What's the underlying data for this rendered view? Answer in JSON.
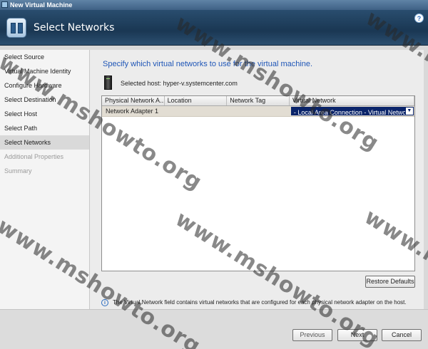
{
  "window": {
    "title": "New Virtual Machine"
  },
  "header": {
    "title": "Select Networks",
    "help_glyph": "?"
  },
  "sidebar": {
    "items": [
      {
        "label": "Select Source",
        "state": "normal"
      },
      {
        "label": "Virtual Machine Identity",
        "state": "normal"
      },
      {
        "label": "Configure Hardware",
        "state": "normal"
      },
      {
        "label": "Select Destination",
        "state": "normal"
      },
      {
        "label": "Select Host",
        "state": "normal"
      },
      {
        "label": "Select Path",
        "state": "normal"
      },
      {
        "label": "Select Networks",
        "state": "active"
      },
      {
        "label": "Additional Properties",
        "state": "disabled"
      },
      {
        "label": "Summary",
        "state": "disabled"
      }
    ]
  },
  "main": {
    "heading": "Specify which virtual networks to use for the virtual machine.",
    "host_label": "Selected host: hyper-v.systemcenter.com",
    "table": {
      "columns": [
        "Physical Network A...",
        "Location",
        "Network Tag",
        "Virtual Network"
      ],
      "rows": [
        {
          "adapter": "Network Adapter 1",
          "location": "",
          "tag": "",
          "network": "- Local Area Connection - Virtual Network"
        }
      ]
    },
    "restore_button": "Restore Defaults",
    "info_text": "The Virtual Network field contains virtual networks that are configured for each physical network adapter on the host."
  },
  "footer": {
    "previous": "Previous",
    "next": "Next",
    "cancel": "Cancel"
  },
  "watermark_text": "www.mshowto.org"
}
